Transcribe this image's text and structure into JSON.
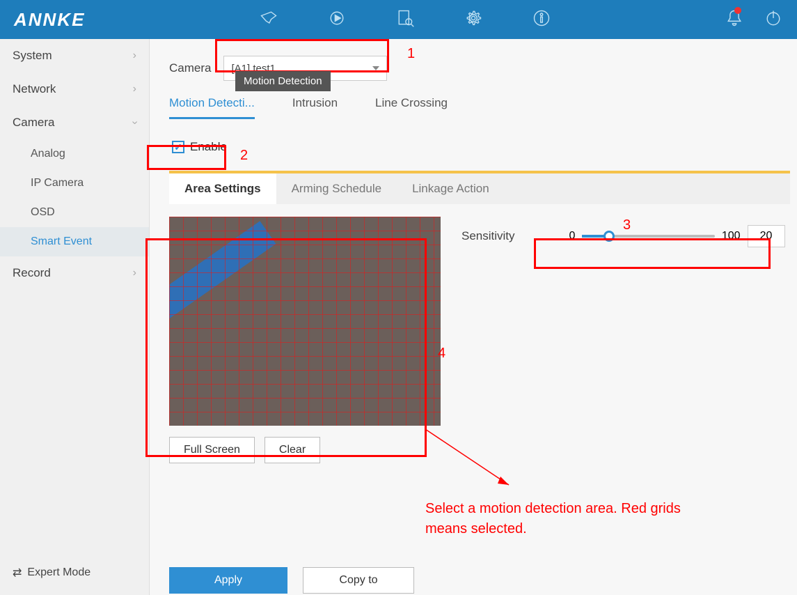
{
  "brand": "ANNKE",
  "topbar_icons": [
    "camera-icon",
    "playback-icon",
    "search-doc-icon",
    "gear-icon",
    "info-icon"
  ],
  "topright_icons": [
    "bell-icon",
    "power-icon"
  ],
  "sidebar": {
    "items": [
      {
        "label": "System",
        "expanded": false
      },
      {
        "label": "Network",
        "expanded": false
      },
      {
        "label": "Camera",
        "expanded": true,
        "children": [
          {
            "label": "Analog"
          },
          {
            "label": "IP Camera"
          },
          {
            "label": "OSD"
          },
          {
            "label": "Smart Event",
            "active": true
          }
        ]
      },
      {
        "label": "Record",
        "expanded": false
      }
    ],
    "expert_mode": "Expert Mode"
  },
  "main": {
    "camera_label": "Camera",
    "camera_select_value": "[A1] test1",
    "tooltip": "Motion Detection",
    "detection_tabs": [
      "Motion Detecti...",
      "Intrusion",
      "Line Crossing"
    ],
    "detection_tab_active": 0,
    "enable_label": "Enable",
    "enable_checked": true,
    "subtabs": [
      "Area Settings",
      "Arming Schedule",
      "Linkage Action"
    ],
    "subtab_active": 0,
    "sensitivity_label": "Sensitivity",
    "sensitivity_min": "0",
    "sensitivity_max": "100",
    "sensitivity_value": "20",
    "fullscreen_btn": "Full Screen",
    "clear_btn": "Clear",
    "apply_btn": "Apply",
    "copy_btn": "Copy to"
  },
  "annotations": {
    "n1": "1",
    "n2": "2",
    "n3": "3",
    "n4": "4",
    "note": "Select a motion detection area. Red grids means selected."
  }
}
